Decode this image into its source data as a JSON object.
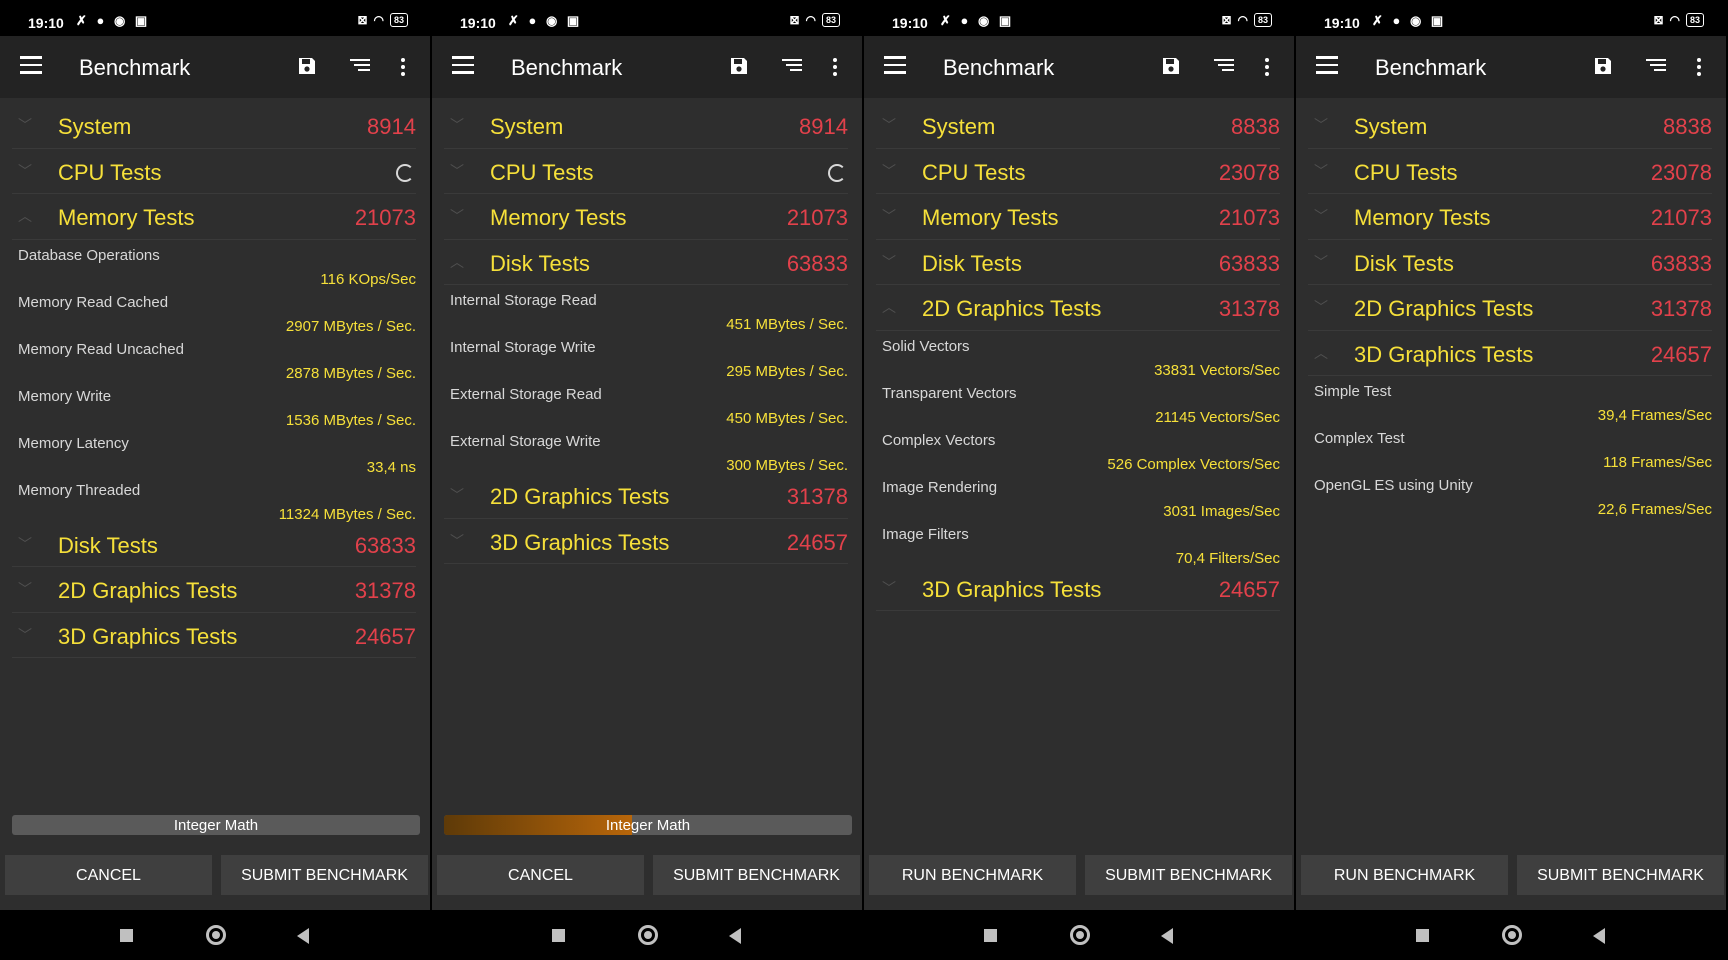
{
  "screens": [
    {
      "status": {
        "time": "19:10",
        "battery": "83"
      },
      "app_title": "Benchmark",
      "groups": [
        {
          "name": "System",
          "score": "8914",
          "expanded": false
        },
        {
          "name": "CPU Tests",
          "score": "",
          "loading": true,
          "expanded": false
        },
        {
          "name": "Memory Tests",
          "score": "21073",
          "expanded": true,
          "items": [
            {
              "label": "Database Operations",
              "value": "116 KOps/Sec"
            },
            {
              "label": "Memory Read Cached",
              "value": "2907 MBytes / Sec."
            },
            {
              "label": "Memory Read Uncached",
              "value": "2878 MBytes / Sec."
            },
            {
              "label": "Memory Write",
              "value": "1536 MBytes / Sec."
            },
            {
              "label": "Memory Latency",
              "value": "33,4 ns"
            },
            {
              "label": "Memory Threaded",
              "value": "11324 MBytes / Sec."
            }
          ]
        },
        {
          "name": "Disk Tests",
          "score": "63833",
          "expanded": false
        },
        {
          "name": "2D Graphics Tests",
          "score": "31378",
          "expanded": false
        },
        {
          "name": "3D Graphics Tests",
          "score": "24657",
          "expanded": false
        }
      ],
      "progress": {
        "label": "Integer Math",
        "fraction": 0.0
      },
      "buttons": {
        "left": "CANCEL",
        "right": "SUBMIT BENCHMARK"
      }
    },
    {
      "status": {
        "time": "19:10",
        "battery": "83"
      },
      "app_title": "Benchmark",
      "groups": [
        {
          "name": "System",
          "score": "8914",
          "expanded": false
        },
        {
          "name": "CPU Tests",
          "score": "",
          "loading": true,
          "expanded": false
        },
        {
          "name": "Memory Tests",
          "score": "21073",
          "expanded": false
        },
        {
          "name": "Disk Tests",
          "score": "63833",
          "expanded": true,
          "items": [
            {
              "label": "Internal Storage Read",
              "value": "451 MBytes / Sec."
            },
            {
              "label": "Internal Storage Write",
              "value": "295 MBytes / Sec."
            },
            {
              "label": "External Storage Read",
              "value": "450 MBytes / Sec."
            },
            {
              "label": "External Storage Write",
              "value": "300 MBytes / Sec."
            }
          ]
        },
        {
          "name": "2D Graphics Tests",
          "score": "31378",
          "expanded": false
        },
        {
          "name": "3D Graphics Tests",
          "score": "24657",
          "expanded": false
        }
      ],
      "progress": {
        "label": "Integer Math",
        "fraction": 0.46
      },
      "buttons": {
        "left": "CANCEL",
        "right": "SUBMIT BENCHMARK"
      }
    },
    {
      "status": {
        "time": "19:10",
        "battery": "83"
      },
      "app_title": "Benchmark",
      "groups": [
        {
          "name": "System",
          "score": "8838",
          "expanded": false
        },
        {
          "name": "CPU Tests",
          "score": "23078",
          "expanded": false
        },
        {
          "name": "Memory Tests",
          "score": "21073",
          "expanded": false
        },
        {
          "name": "Disk Tests",
          "score": "63833",
          "expanded": false
        },
        {
          "name": "2D Graphics Tests",
          "score": "31378",
          "expanded": true,
          "items": [
            {
              "label": "Solid Vectors",
              "value": "33831 Vectors/Sec"
            },
            {
              "label": "Transparent Vectors",
              "value": "21145 Vectors/Sec"
            },
            {
              "label": "Complex Vectors",
              "value": "526 Complex Vectors/Sec"
            },
            {
              "label": "Image Rendering",
              "value": "3031 Images/Sec"
            },
            {
              "label": "Image Filters",
              "value": "70,4 Filters/Sec"
            }
          ]
        },
        {
          "name": "3D Graphics Tests",
          "score": "24657",
          "expanded": false
        }
      ],
      "progress": null,
      "buttons": {
        "left": "RUN BENCHMARK",
        "right": "SUBMIT BENCHMARK"
      }
    },
    {
      "status": {
        "time": "19:10",
        "battery": "83"
      },
      "app_title": "Benchmark",
      "groups": [
        {
          "name": "System",
          "score": "8838",
          "expanded": false
        },
        {
          "name": "CPU Tests",
          "score": "23078",
          "expanded": false
        },
        {
          "name": "Memory Tests",
          "score": "21073",
          "expanded": false
        },
        {
          "name": "Disk Tests",
          "score": "63833",
          "expanded": false
        },
        {
          "name": "2D Graphics Tests",
          "score": "31378",
          "expanded": false
        },
        {
          "name": "3D Graphics Tests",
          "score": "24657",
          "expanded": true,
          "items": [
            {
              "label": "Simple Test",
              "value": "39,4 Frames/Sec"
            },
            {
              "label": "Complex Test",
              "value": "118 Frames/Sec"
            },
            {
              "label": "OpenGL ES using Unity",
              "value": "22,6 Frames/Sec"
            }
          ]
        }
      ],
      "progress": null,
      "buttons": {
        "left": "RUN BENCHMARK",
        "right": "SUBMIT BENCHMARK"
      }
    }
  ],
  "colors": {
    "category_text": "#f6e03a",
    "score_text": "#e2414b",
    "background": "#2e2e2e",
    "progress_fill": "#b8660a"
  },
  "icons": [
    "menu-icon",
    "save-icon",
    "sort-icon",
    "more-vert-icon",
    "chevron-icon",
    "spinner-icon",
    "recents-icon",
    "home-icon",
    "back-icon"
  ]
}
